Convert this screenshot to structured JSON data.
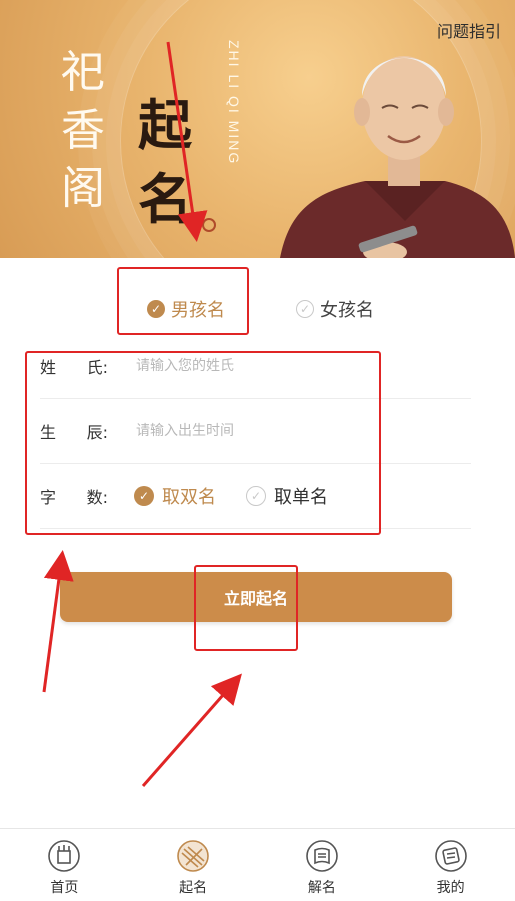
{
  "banner": {
    "logo_text": "祀香阁",
    "title": "起名",
    "pinyin": "ZHI LI QI MING",
    "help_link": "问题指引"
  },
  "gender": {
    "boy": "男孩名",
    "girl": "女孩名",
    "selected": "boy"
  },
  "form": {
    "surname_label_a": "姓",
    "surname_label_b": "氏:",
    "surname_placeholder": "请输入您的姓氏",
    "birth_label_a": "生",
    "birth_label_b": "辰:",
    "birth_placeholder": "请输入出生时间",
    "count_label_a": "字",
    "count_label_b": "数:",
    "double": "取双名",
    "single": "取单名",
    "count_selected": "double"
  },
  "submit_label": "立即起名",
  "nav": {
    "items": [
      {
        "label": "首页",
        "icon": "home-icon"
      },
      {
        "label": "起名",
        "icon": "naming-icon"
      },
      {
        "label": "解名",
        "icon": "interpret-icon"
      },
      {
        "label": "我的",
        "icon": "profile-icon"
      }
    ]
  },
  "colors": {
    "accent": "#bf8a4e",
    "button": "#cc8c4a",
    "annotation": "#e02525"
  }
}
